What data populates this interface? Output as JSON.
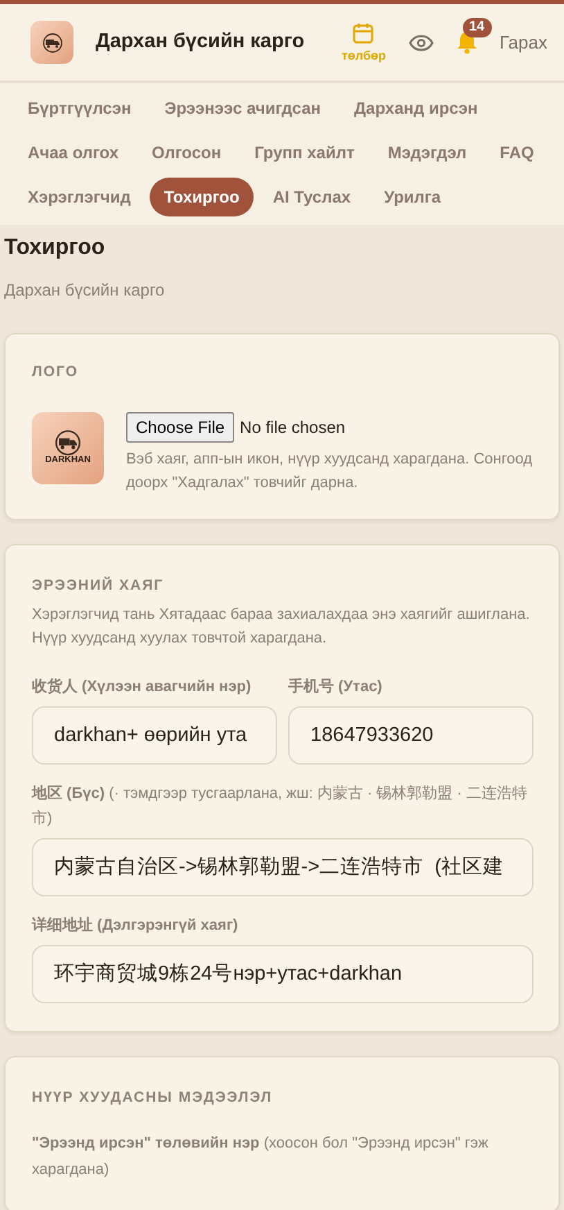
{
  "header": {
    "title": "Дархан бүсийн карго",
    "calendar_label": "төлбөр",
    "notification_count": "14",
    "logout": "Гарах"
  },
  "nav": [
    {
      "label": "Бүртгүүлсэн",
      "selected": false
    },
    {
      "label": "Эрээнээс ачигдсан",
      "selected": false
    },
    {
      "label": "Дарханд ирсэн",
      "selected": false
    },
    {
      "label": "Ачаа олгох",
      "selected": false
    },
    {
      "label": "Олгосон",
      "selected": false
    },
    {
      "label": "Групп хайлт",
      "selected": false
    },
    {
      "label": "Мэдэгдэл",
      "selected": false
    },
    {
      "label": "FAQ",
      "selected": false
    },
    {
      "label": "Хэрэглэгчид",
      "selected": false
    },
    {
      "label": "Тохиргоо",
      "selected": true
    },
    {
      "label": "AI Туслах",
      "selected": false
    },
    {
      "label": "Урилга",
      "selected": false
    }
  ],
  "page": {
    "title": "Тохиргоо",
    "subtitle": "Дархан бүсийн карго"
  },
  "logo_card": {
    "heading": "ЛОГО",
    "logo_text": "DARKHAN",
    "file_button": "Choose File",
    "file_status": "No file chosen",
    "help": "Вэб хаяг, апп-ын икон, нүүр хуудсанд харагдана. Сонгоод доорх \"Хадгалах\" товчийг дарна."
  },
  "address_card": {
    "heading": "ЭРЭЭНИЙ ХАЯГ",
    "help": "Хэрэглэгчид тань Хятадаас бараа захиалахдаа энэ хаягийг ашиглана. Нүүр хуудсанд хуулах товчтой харагдана.",
    "field_rows": [
      {
        "fields": [
          {
            "label": "**收货人 (Хүлээн авагчийн нэр)**",
            "value": "darkhan+ өөрийн ута"
          },
          {
            "label": "**手机号 (Утас)**",
            "value": "18647933620"
          }
        ]
      },
      {
        "fields": [
          {
            "label": "**地区 (Бүс)** (· тэмдгээр тусгаарлана, жш: 内蒙古 · 锡林郭勒盟 · 二连浩特市)",
            "value": "内蒙古自治区->锡林郭勒盟->二连浩特市  (社区建"
          }
        ]
      },
      {
        "fields": [
          {
            "label": "**详细地址 (Дэлгэрэнгүй хаяг)**",
            "value": "环宇商贸城9栋24号нэр+утас+darkhan"
          }
        ]
      }
    ]
  },
  "home_card": {
    "heading": "НҮҮР ХУУДАСНЫ МЭДЭЭЛЭЛ",
    "label": "**\"Эрээнд ирсэн\" төлөвийн нэр** (хоосон бол \"Эрээнд ирсэн\" гэж харагдана)"
  }
}
